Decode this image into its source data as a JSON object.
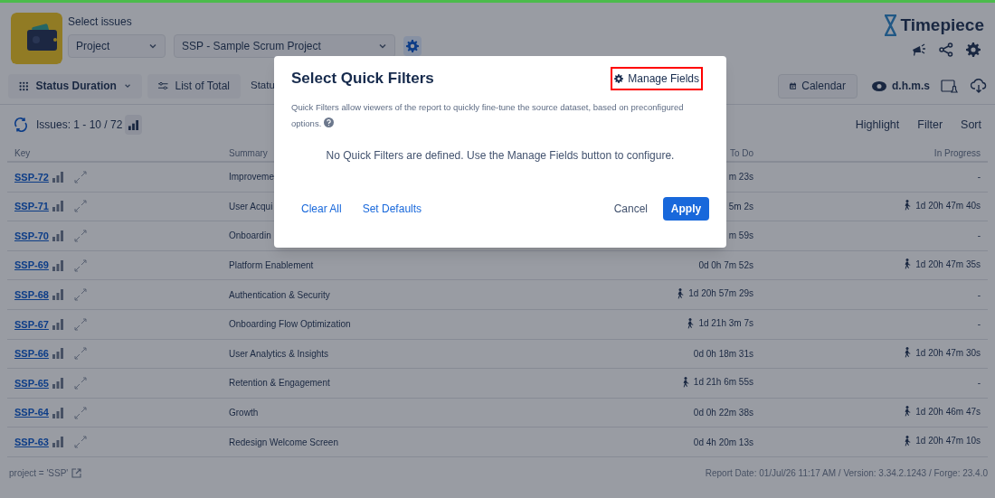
{
  "header": {
    "select_label": "Select issues",
    "scope": "Project",
    "project": "SSP - Sample Scrum Project",
    "brand": "Timepiece"
  },
  "toolbar": {
    "view": "Status Duration",
    "list": "List of Total",
    "cut_button": "Statu",
    "calendar": "Calendar",
    "format": "d.h.m.s"
  },
  "issues": {
    "count": "Issues: 1 - 10 / 72",
    "actions": [
      "Highlight",
      "Filter",
      "Sort"
    ]
  },
  "table": {
    "columns": [
      "Key",
      "Summary",
      "To Do",
      "In Progress"
    ],
    "rows": [
      {
        "key": "SSP-72",
        "summary": "Improveme",
        "todo": {
          "text": "m 23s"
        },
        "in_progress": {
          "text": "-",
          "current": false
        }
      },
      {
        "key": "SSP-71",
        "summary": "User Acqui",
        "todo": {
          "text": "5m 2s"
        },
        "in_progress": {
          "text": "1d 20h 47m 40s",
          "current": true
        }
      },
      {
        "key": "SSP-70",
        "summary": "Onboardin",
        "todo": {
          "text": "m 59s"
        },
        "in_progress": {
          "text": "-",
          "current": false
        }
      },
      {
        "key": "SSP-69",
        "summary": "Platform Enablement",
        "todo": {
          "text": "0d 0h 7m 52s",
          "current": false
        },
        "in_progress": {
          "text": "1d 20h 47m 35s",
          "current": true
        }
      },
      {
        "key": "SSP-68",
        "summary": "Authentication & Security",
        "todo": {
          "text": "1d 20h 57m 29s",
          "current": true
        },
        "in_progress": {
          "text": "-",
          "current": false
        }
      },
      {
        "key": "SSP-67",
        "summary": "Onboarding Flow Optimization",
        "todo": {
          "text": "1d 21h 3m 7s",
          "current": true
        },
        "in_progress": {
          "text": "-",
          "current": false
        }
      },
      {
        "key": "SSP-66",
        "summary": "User Analytics & Insights",
        "todo": {
          "text": "0d 0h 18m 31s",
          "current": false
        },
        "in_progress": {
          "text": "1d 20h 47m 30s",
          "current": true
        }
      },
      {
        "key": "SSP-65",
        "summary": "Retention & Engagement",
        "todo": {
          "text": "1d 21h 6m 55s",
          "current": true
        },
        "in_progress": {
          "text": "-",
          "current": false
        }
      },
      {
        "key": "SSP-64",
        "summary": "Growth",
        "todo": {
          "text": "0d 0h 22m 38s",
          "current": false
        },
        "in_progress": {
          "text": "1d 20h 46m 47s",
          "current": true
        }
      },
      {
        "key": "SSP-63",
        "summary": "Redesign Welcome Screen",
        "todo": {
          "text": "0d 4h 20m 13s",
          "current": false
        },
        "in_progress": {
          "text": "1d 20h 47m 10s",
          "current": true
        }
      }
    ]
  },
  "footer": {
    "query": "project = 'SSP'",
    "info": "Report Date: 01/Jul/26 11:17 AM / Version: 3.34.2.1243 / Forge: 23.4.0"
  },
  "dialog": {
    "title": "Select Quick Filters",
    "manage": "Manage Fields",
    "description": "Quick Filters allow viewers of the report to quickly fine-tune the source dataset, based on preconfigured options.",
    "empty": "No Quick Filters are defined. Use the Manage Fields button to configure.",
    "left_actions": [
      "Clear All",
      "Set Defaults"
    ],
    "cancel": "Cancel",
    "apply": "Apply"
  }
}
